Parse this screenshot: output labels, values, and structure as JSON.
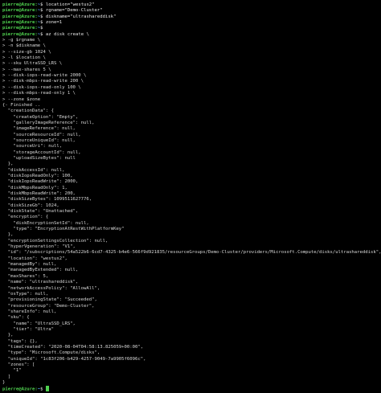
{
  "terminal": {
    "user": "pierre@Azure",
    "path": "~",
    "commands": [
      "location=\"westus2\"",
      "rgname=\"Demo-Cluster\"",
      "diskname=\"ultrashareddisk\"",
      "zone=1",
      "",
      "az disk create \\"
    ],
    "continuation": [
      "> -g $rgname \\",
      "> -n $diskname \\",
      "> --size-gb 1024 \\",
      "> -l $location \\",
      "> --sku UltraSSD_LRS \\",
      "> --max-shares 5 \\",
      "> --disk-iops-read-write 2000 \\",
      "> --disk-mbps-read-write 200 \\",
      "> --disk-iops-read-only 100 \\",
      "> --disk-mbps-read-only 1 \\",
      "> --zone $zone"
    ],
    "output": [
      "{- Finished ..",
      "  \"creationData\": {",
      "    \"createOption\": \"Empty\",",
      "    \"galleryImageReference\": null,",
      "    \"imageReference\": null,",
      "    \"sourceResourceId\": null,",
      "    \"sourceUniqueId\": null,",
      "    \"sourceUri\": null,",
      "    \"storageAccountId\": null,",
      "    \"uploadSizeBytes\": null",
      "  },",
      "  \"diskAccessId\": null,",
      "  \"diskIopsReadOnly\": 100,",
      "  \"diskIopsReadWrite\": 2000,",
      "  \"diskMbpsReadOnly\": 1,",
      "  \"diskMbpsReadWrite\": 200,",
      "  \"diskSizeBytes\": 1099511627776,",
      "  \"diskSizeGb\": 1024,",
      "  \"diskState\": \"Unattached\",",
      "  \"encryption\": {",
      "    \"diskEncryptionSetId\": null,",
      "    \"type\": \"EncryptionAtRestWithPlatformKey\"",
      "  },",
      "  \"encryptionSettingsCollection\": null,",
      "  \"hyperVgeneration\": \"V1\",",
      "  \"id\": \"/subscriptions/54a522b6-6cd7-4325-b4e6-566f9d921835/resourceGroups/Demo-Cluster/providers/Microsoft.Compute/disks/ultrashareddisk\",",
      "  \"location\": \"westus2\",",
      "  \"managedBy\": null,",
      "  \"managedByExtended\": null,",
      "  \"maxShares\": 5,",
      "  \"name\": \"ultrashareddisk\",",
      "  \"networkAccessPolicy\": \"AllowAll\",",
      "  \"osType\": null,",
      "  \"provisioningState\": \"Succeeded\",",
      "  \"resourceGroup\": \"Demo-Cluster\",",
      "  \"shareInfo\": null,",
      "  \"sku\": {",
      "    \"name\": \"UltraSSD_LRS\",",
      "    \"tier\": \"Ultra\"",
      "  },",
      "  \"tags\": {},",
      "  \"timeCreated\": \"2020-08-04T04:58:13.825059+00:00\",",
      "  \"type\": \"Microsoft.Compute/disks\",",
      "  \"uniqueId\": \"1c83f206-b429-4257-9049-7a9905f6096c\",",
      "  \"zones\": [",
      "    \"1\"",
      "  ]",
      "}"
    ]
  },
  "colors": {
    "background": "#000000",
    "prompt": "#4fd14f",
    "path": "#5aa0ff",
    "text": "#d8d8d8"
  }
}
